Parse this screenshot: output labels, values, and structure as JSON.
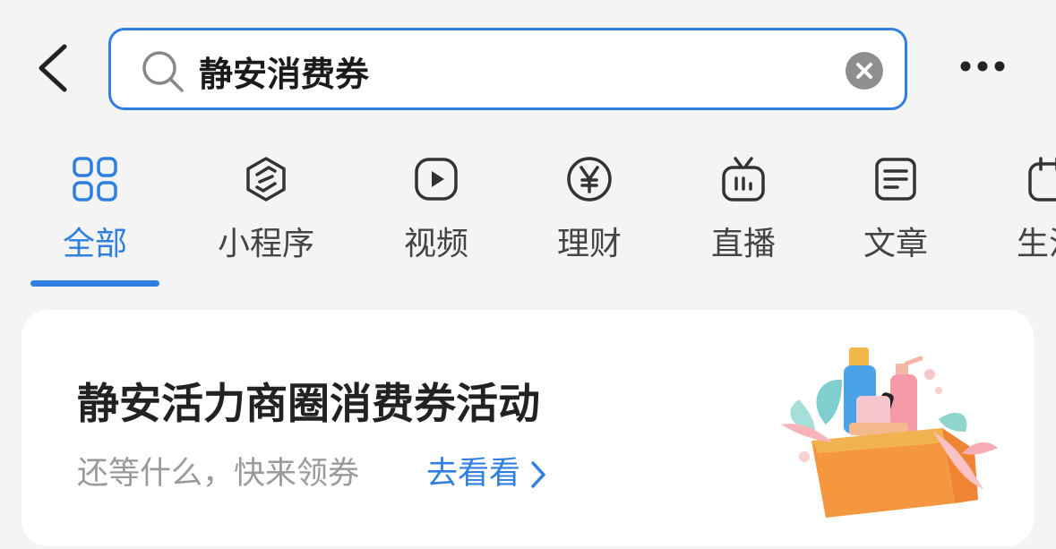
{
  "search": {
    "query": "静安消费券"
  },
  "tabs": [
    {
      "label": "全部",
      "icon": "grid-icon",
      "active": true
    },
    {
      "label": "小程序",
      "icon": "mini-program-icon",
      "active": false
    },
    {
      "label": "视频",
      "icon": "play-icon",
      "active": false
    },
    {
      "label": "理财",
      "icon": "yen-icon",
      "active": false
    },
    {
      "label": "直播",
      "icon": "live-tv-icon",
      "active": false
    },
    {
      "label": "文章",
      "icon": "article-icon",
      "active": false
    },
    {
      "label": "生活",
      "icon": "life-icon",
      "active": false
    }
  ],
  "promo": {
    "title": "静安活力商圈消费券活动",
    "subtitle": "还等什么，快来领券",
    "link_label": "去看看"
  },
  "colors": {
    "accent": "#2f7fe0",
    "background": "#f4f4f4",
    "card": "#ffffff"
  }
}
